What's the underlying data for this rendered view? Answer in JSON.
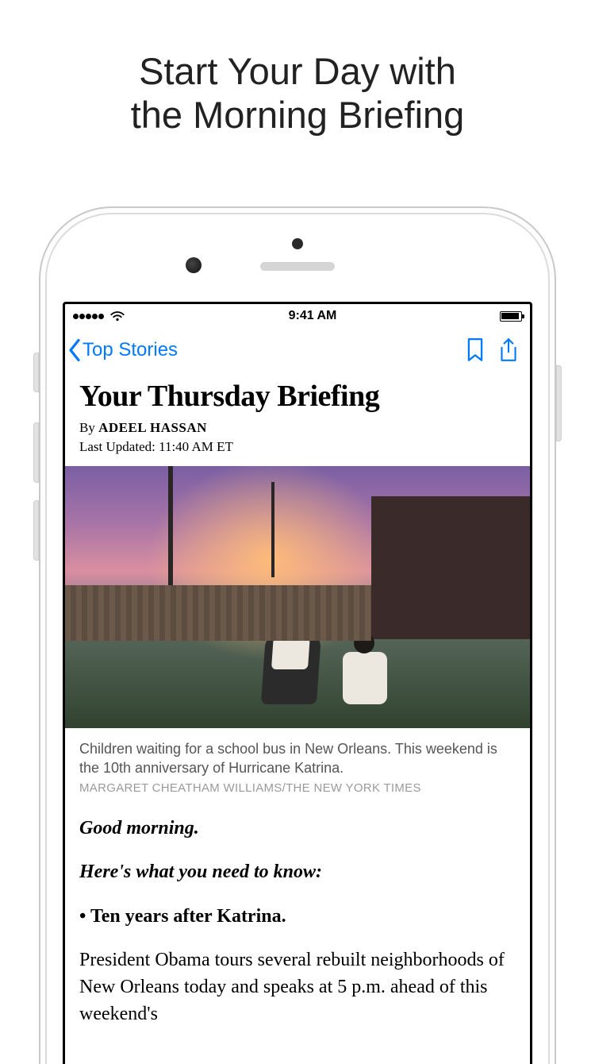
{
  "promo": {
    "line1": "Start Your Day with",
    "line2": "the Morning Briefing"
  },
  "statusbar": {
    "time": "9:41 AM"
  },
  "navbar": {
    "back_label": "Top Stories"
  },
  "article": {
    "headline": "Your Thursday Briefing",
    "byline_prefix": "By ",
    "author": "ADEEL HASSAN",
    "updated": "Last Updated: 11:40 AM ET",
    "caption": "Children waiting for a school bus in New Orleans. This weekend is the 10th anniversary of Hurricane Katrina.",
    "credit": "MARGARET CHEATHAM WILLIAMS/THE NEW YORK TIMES",
    "greeting": "Good morning.",
    "lead": "Here's what you need to know:",
    "bullet1": "• Ten years after Katrina.",
    "para1": "President Obama tours several rebuilt neighborhoods of New Orleans today and speaks at 5 p.m. ahead of this weekend's"
  }
}
